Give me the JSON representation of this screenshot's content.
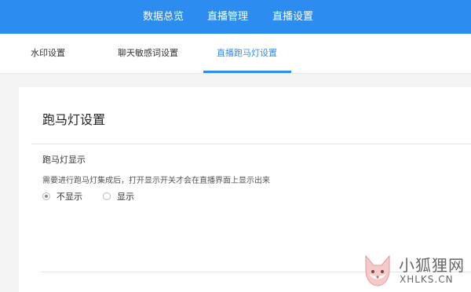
{
  "top_nav": {
    "items": [
      "数据总览",
      "直播管理",
      "直播设置"
    ]
  },
  "sub_nav": {
    "tabs": [
      "水印设置",
      "聊天敏感词设置",
      "直播跑马灯设置"
    ],
    "active_index": 2
  },
  "card": {
    "title": "跑马灯设置",
    "section_label": "跑马灯显示",
    "description": "需要进行跑马灯集成后，打开显示开关才会在直播界面上显示出来",
    "options": [
      {
        "label": "不显示",
        "checked": true
      },
      {
        "label": "显示",
        "checked": false
      }
    ]
  },
  "watermark": {
    "cn": "小狐狸网",
    "en": "XHLKS.CN",
    "icon": "fox-logo-icon"
  },
  "colors": {
    "accent": "#2d8cf0",
    "page_bg": "#f4f4f5"
  }
}
